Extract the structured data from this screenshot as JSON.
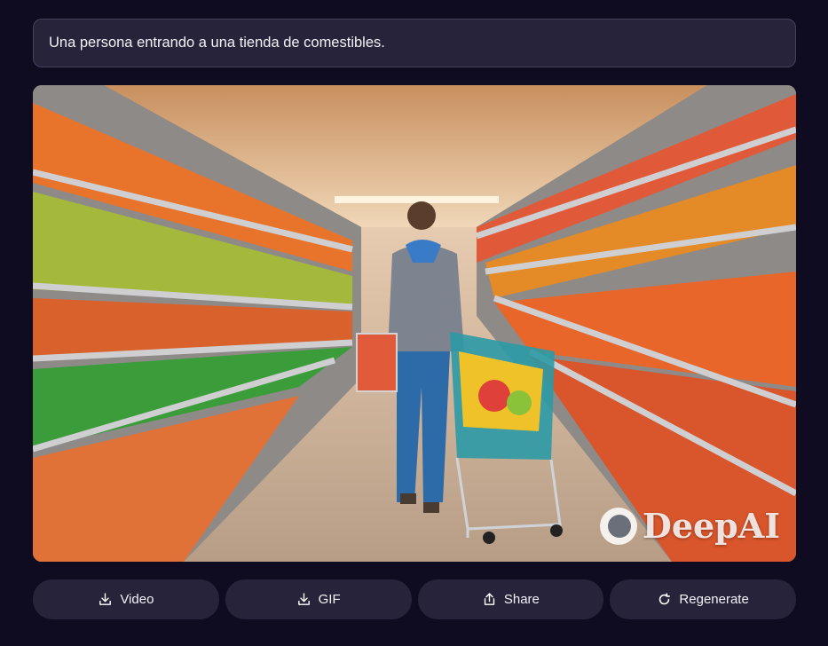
{
  "prompt": {
    "text": "Una persona entrando a una tienda de comestibles."
  },
  "result_image": {
    "subject": "person with shopping cart in supermarket aisle of colorful produce",
    "watermark_text": "DeepAI"
  },
  "actions": [
    {
      "label": "Video",
      "icon": "download-icon"
    },
    {
      "label": "GIF",
      "icon": "download-icon"
    },
    {
      "label": "Share",
      "icon": "share-icon"
    },
    {
      "label": "Regenerate",
      "icon": "refresh-icon"
    }
  ],
  "colors": {
    "background": "#0f0c22",
    "surface": "#27233a",
    "border": "#45405c",
    "text": "#f2f2f6"
  }
}
